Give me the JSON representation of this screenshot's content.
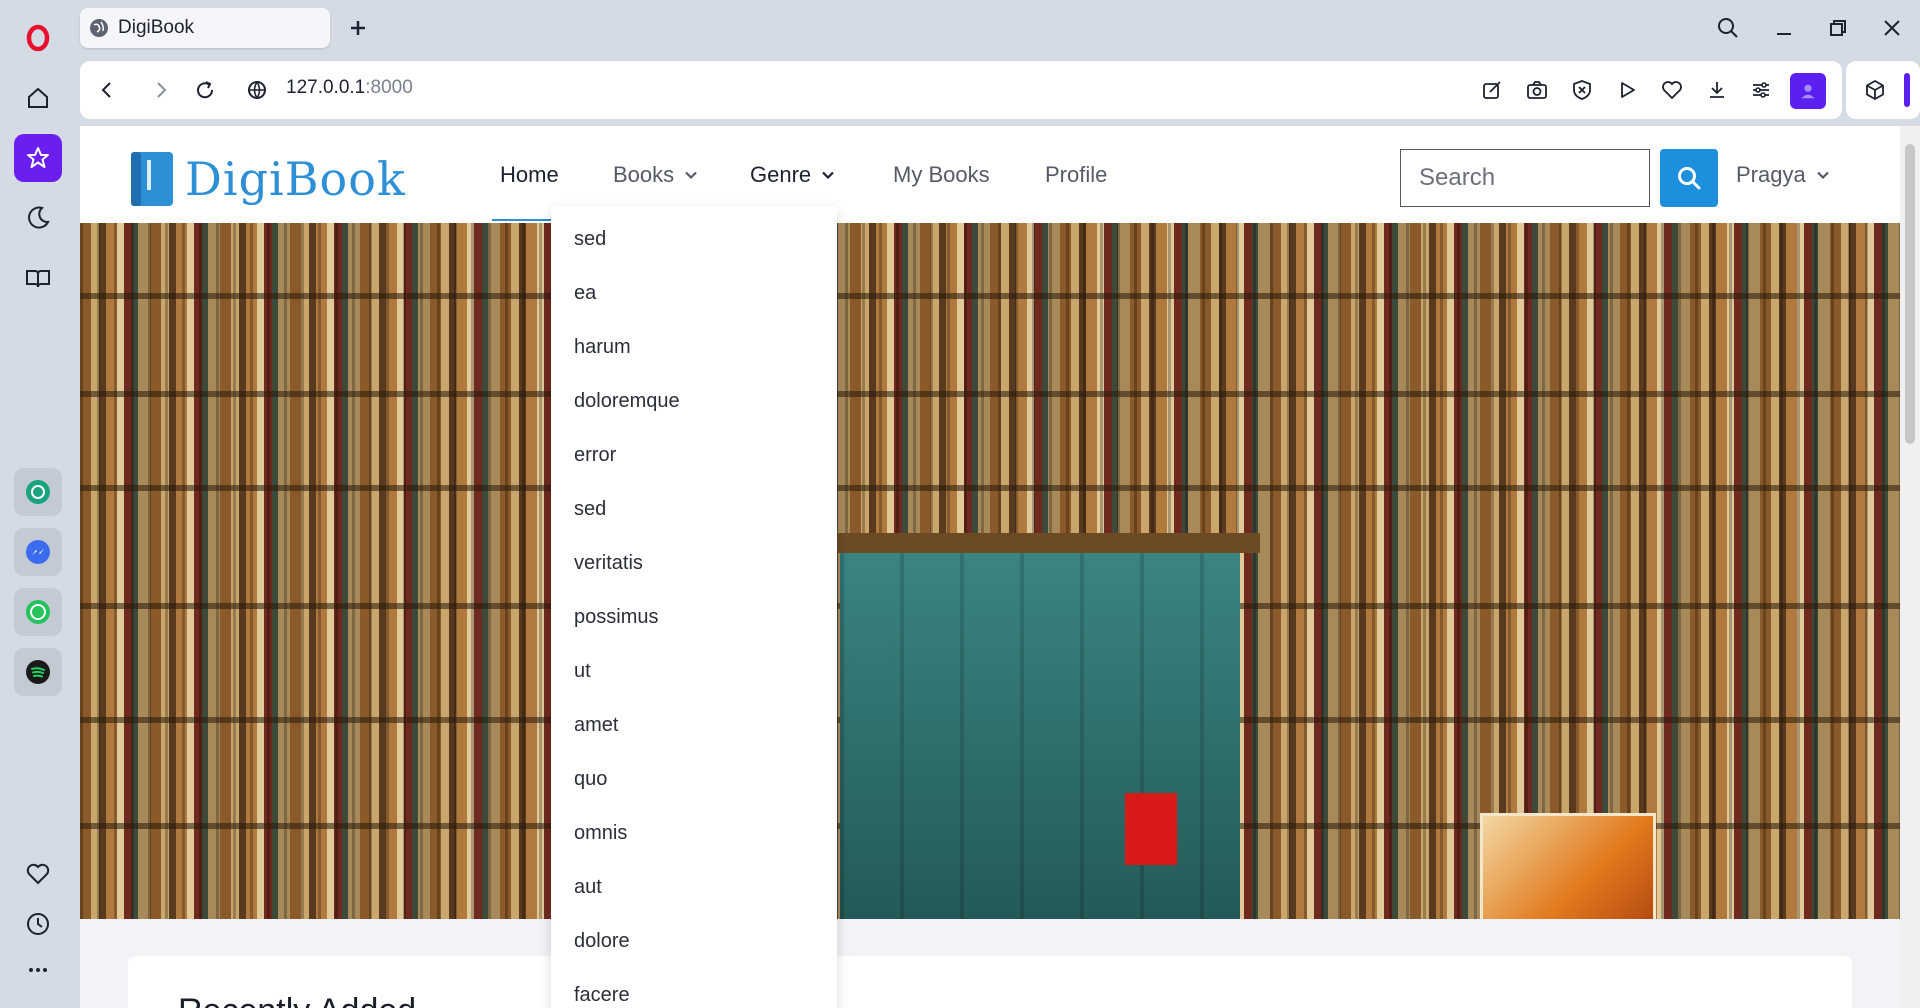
{
  "browser": {
    "tab_title": "DigiBook",
    "url_host": "127.0.0.1",
    "url_port": ":8000"
  },
  "site": {
    "logo_text": "DigiBook",
    "nav": {
      "home": "Home",
      "books": "Books",
      "genre": "Genre",
      "my_books": "My Books",
      "profile": "Profile"
    },
    "search_placeholder": "Search",
    "user_name": "Pragya",
    "section_title": "Recently Added"
  },
  "genre_dropdown": {
    "items": [
      "sed",
      "ea",
      "harum",
      "doloremque",
      "error",
      "sed",
      "veritatis",
      "possimus",
      "ut",
      "amet",
      "quo",
      "omnis",
      "aut",
      "dolore",
      "facere"
    ]
  },
  "colors": {
    "brand": "#2d8fd6",
    "search_button": "#1e8fdc",
    "opera_accent": "#6a1ff0"
  }
}
